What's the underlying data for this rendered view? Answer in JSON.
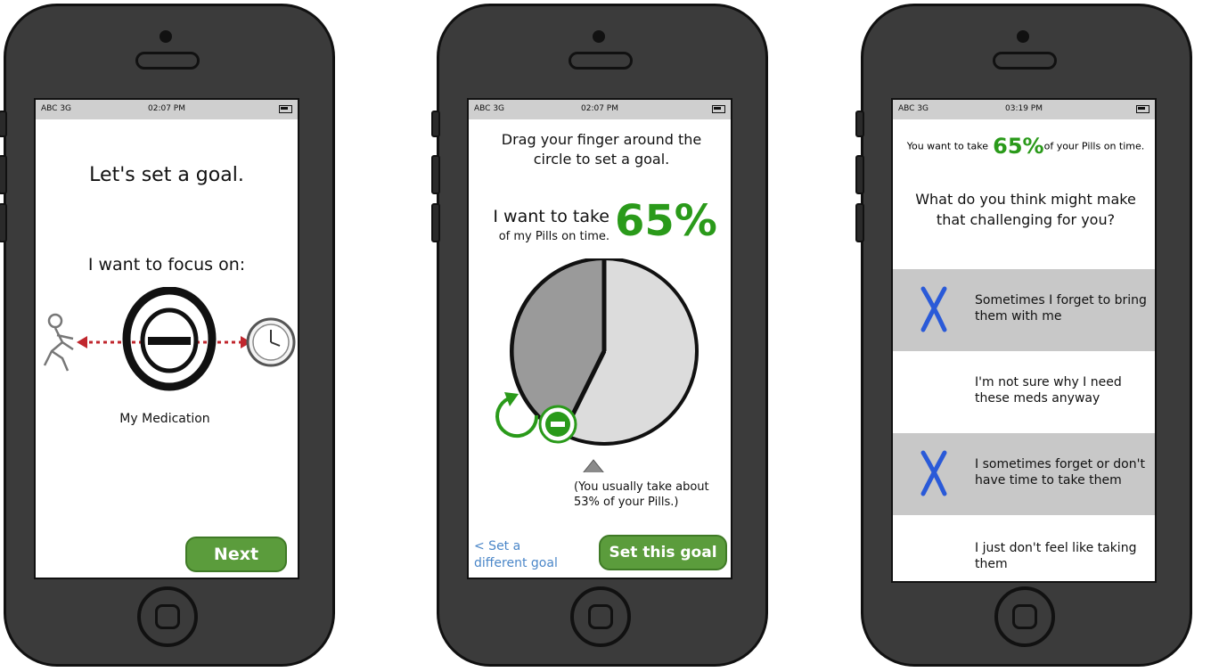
{
  "status_bar": {
    "carrier": "ABC 3G"
  },
  "screen1": {
    "time": "02:07 PM",
    "title": "Let's set a goal.",
    "prompt": "I want to focus on:",
    "option_label": "My Medication",
    "next_label": "Next"
  },
  "screen2": {
    "time": "02:07 PM",
    "instruction": "Drag your finger around the circle to set a goal.",
    "want_line1": "I want to take",
    "want_line2": "of my Pills on time.",
    "goal_percent": "65%",
    "usual_note": "(You usually take about 53% of your Pills.)",
    "back_link": "< Set a different goal",
    "set_button": "Set this goal",
    "colors": {
      "green": "#2a9a1a",
      "link": "#4a86c8"
    }
  },
  "screen3": {
    "time": "03:19 PM",
    "summary_pre": "You want to take",
    "summary_percent": "65%",
    "summary_post": "of your Pills on time.",
    "question": "What do you think might make that challenging for you?",
    "choices": [
      {
        "label": "Sometimes I forget to bring them with me",
        "selected": true
      },
      {
        "label": "I'm not sure why I need these meds anyway",
        "selected": false
      },
      {
        "label": "I sometimes forget or don't have time to take them",
        "selected": true
      },
      {
        "label": "I just don't feel like taking them",
        "selected": false
      }
    ]
  }
}
